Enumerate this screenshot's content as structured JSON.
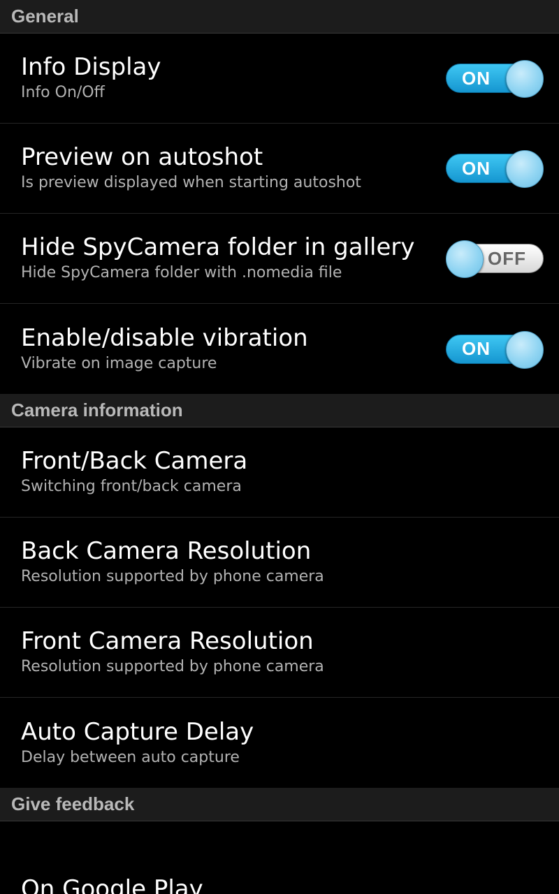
{
  "sections": [
    {
      "header": "General",
      "items": [
        {
          "title": "Info Display",
          "summary": "Info On/Off",
          "toggle": {
            "state": "on",
            "label": "ON"
          }
        },
        {
          "title": "Preview on autoshot",
          "summary": "Is preview displayed when starting autoshot",
          "toggle": {
            "state": "on",
            "label": "ON"
          }
        },
        {
          "title": "Hide SpyCamera folder in gallery",
          "summary": "Hide SpyCamera folder with .nomedia file",
          "toggle": {
            "state": "off",
            "label": "OFF"
          }
        },
        {
          "title": "Enable/disable vibration",
          "summary": "Vibrate on image capture",
          "toggle": {
            "state": "on",
            "label": "ON"
          }
        }
      ]
    },
    {
      "header": "Camera information",
      "items": [
        {
          "title": "Front/Back Camera",
          "summary": "Switching front/back camera"
        },
        {
          "title": "Back Camera Resolution",
          "summary": "Resolution supported by phone camera"
        },
        {
          "title": "Front Camera Resolution",
          "summary": "Resolution supported by phone camera"
        },
        {
          "title": "Auto Capture Delay",
          "summary": "Delay between auto capture"
        }
      ]
    },
    {
      "header": "Give feedback",
      "items": [
        {
          "title": "On Google Play"
        }
      ]
    }
  ],
  "colors": {
    "toggle_on": "#1596d0",
    "header_bg": "#1c1c1c",
    "header_text": "#b9b9b9"
  }
}
